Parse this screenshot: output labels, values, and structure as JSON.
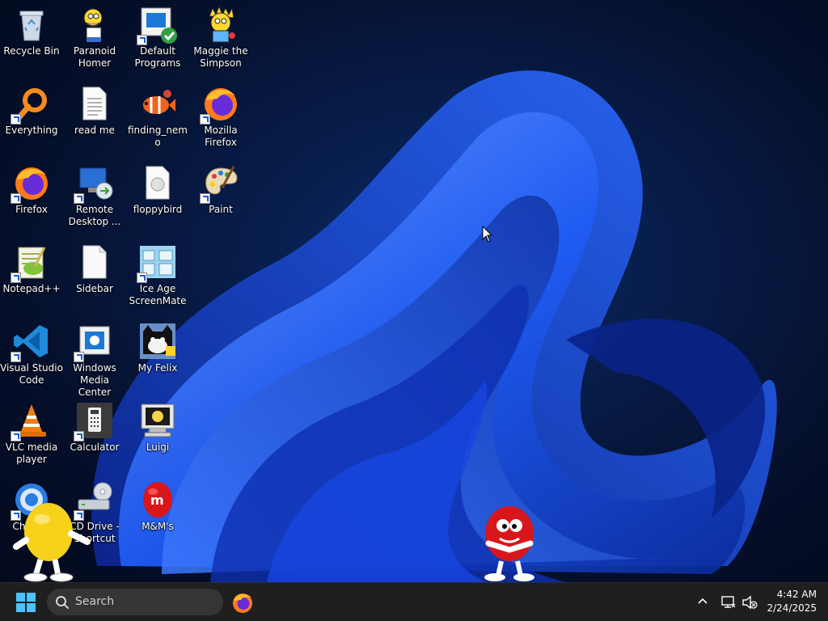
{
  "desktop": {
    "icons": [
      {
        "label": "Recycle Bin"
      },
      {
        "label": "Paranoid Homer"
      },
      {
        "label": "Default Programs"
      },
      {
        "label": "Maggie the Simpson"
      },
      {
        "label": "Everything"
      },
      {
        "label": "read me"
      },
      {
        "label": "finding_nemo"
      },
      {
        "label": "Mozilla Firefox"
      },
      {
        "label": "Firefox"
      },
      {
        "label": "Remote Desktop ..."
      },
      {
        "label": "floppybird"
      },
      {
        "label": "Paint"
      },
      {
        "label": "Notepad++"
      },
      {
        "label": "Sidebar"
      },
      {
        "label": "Ice Age ScreenMate"
      },
      {
        "label": "Visual Studio Code"
      },
      {
        "label": "Windows Media Center"
      },
      {
        "label": "My Felix"
      },
      {
        "label": "VLC media player"
      },
      {
        "label": "Calculator"
      },
      {
        "label": "Luigi"
      },
      {
        "label": "Chrome"
      },
      {
        "label": "CD Drive - Shortcut"
      },
      {
        "label": "M&M's"
      }
    ]
  },
  "taskbar": {
    "search_placeholder": "Search",
    "clock_time": "4:42 AM",
    "clock_date": "2/24/2025",
    "pinned": [
      "firefox-icon"
    ],
    "tray": [
      "chevron-up-icon",
      "network-icon",
      "volume-muted-icon"
    ]
  },
  "colors": {
    "taskbar_bg": "#1f1f1f",
    "search_bg": "#353535",
    "wallpaper_accent": "#1e5bff"
  }
}
